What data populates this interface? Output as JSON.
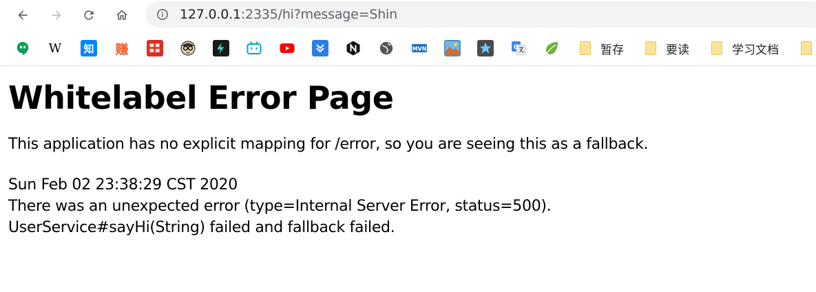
{
  "browser": {
    "url_host": "127.0.0.1",
    "url_rest": ":2335/hi?message=Shin",
    "bookmarks": {
      "wikipedia": "W",
      "zhihu": "知",
      "zhuan": "赚",
      "folders": [
        "暂存",
        "要读",
        "学习文档"
      ]
    }
  },
  "page": {
    "title": "Whitelabel Error Page",
    "description": "This application has no explicit mapping for /error, so you are seeing this as a fallback.",
    "timestamp": "Sun Feb 02 23:38:29 CST 2020",
    "error_line": "There was an unexpected error (type=Internal Server Error, status=500).",
    "message": "UserService#sayHi(String) failed and fallback failed."
  },
  "colors": {
    "accent_youtube": "#ff0000",
    "accent_zhihu": "#0084ff",
    "omnibox_bg": "#f1f3f4"
  }
}
